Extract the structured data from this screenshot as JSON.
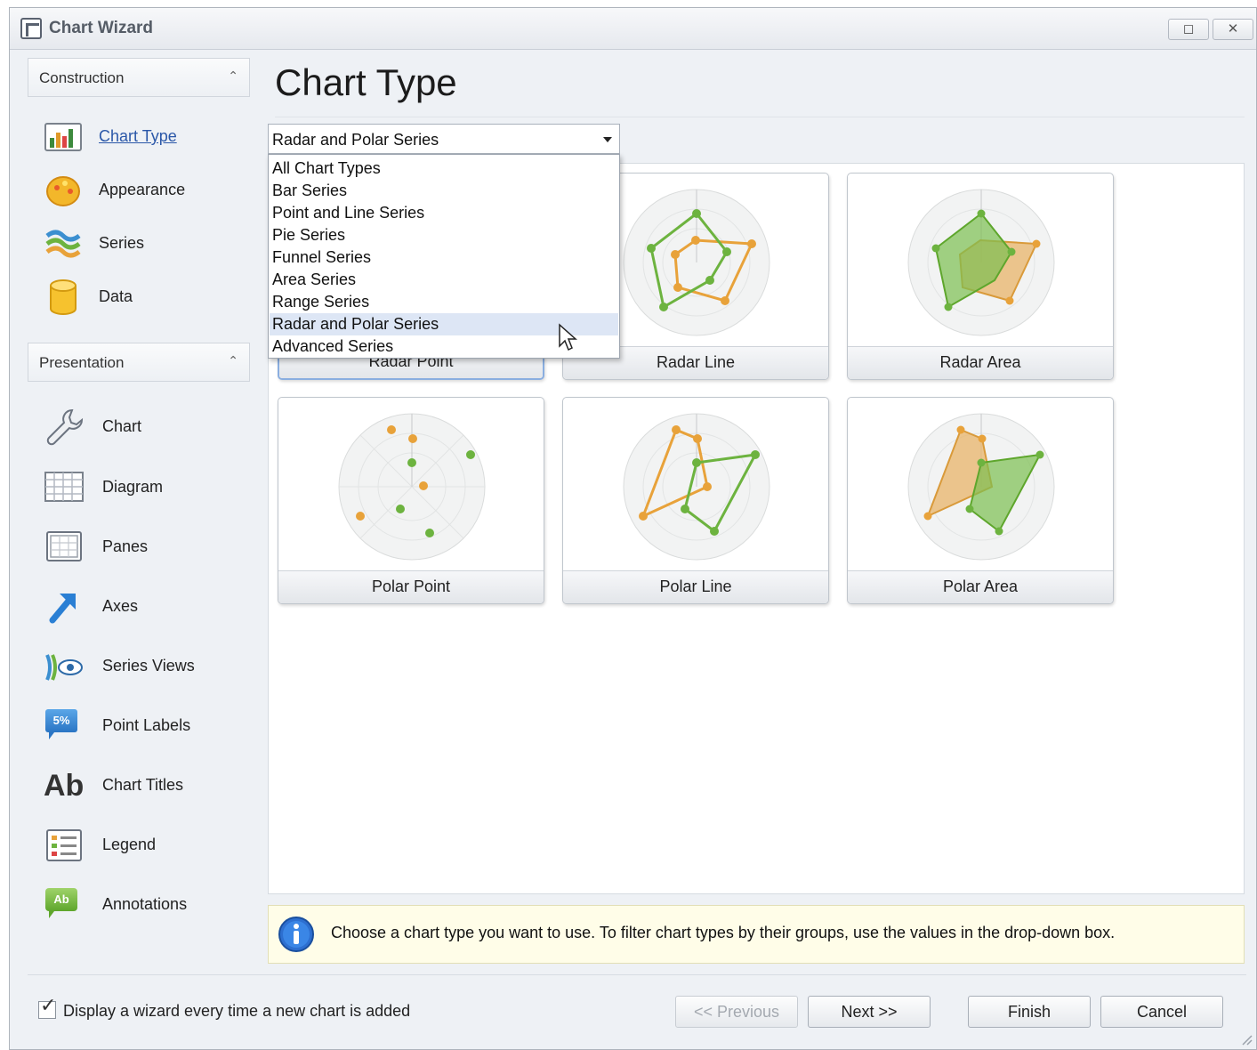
{
  "window": {
    "title": "Chart Wizard",
    "maximize_glyph": "◻",
    "close_glyph": "✕"
  },
  "sidebar": {
    "groups": [
      {
        "label": "Construction",
        "items": [
          {
            "label": "Chart Type",
            "icon": "bar-chart-icon",
            "active": true
          },
          {
            "label": "Appearance",
            "icon": "palette-icon"
          },
          {
            "label": "Series",
            "icon": "series-icon"
          },
          {
            "label": "Data",
            "icon": "database-icon"
          }
        ]
      },
      {
        "label": "Presentation",
        "items": [
          {
            "label": "Chart",
            "icon": "wrench-icon"
          },
          {
            "label": "Diagram",
            "icon": "diagram-grid-icon"
          },
          {
            "label": "Panes",
            "icon": "panes-icon"
          },
          {
            "label": "Axes",
            "icon": "axes-arrow-icon"
          },
          {
            "label": "Series Views",
            "icon": "series-views-icon"
          },
          {
            "label": "Point Labels",
            "icon": "point-labels-icon",
            "badge": "5%"
          },
          {
            "label": "Chart Titles",
            "icon": "chart-titles-icon",
            "glyph": "Ab"
          },
          {
            "label": "Legend",
            "icon": "legend-icon"
          },
          {
            "label": "Annotations",
            "icon": "annotations-icon",
            "badge": "Ab"
          }
        ]
      }
    ]
  },
  "main": {
    "title": "Chart Type",
    "filter": {
      "selected": "Radar and Polar Series",
      "options": [
        "All Chart Types",
        "Bar Series",
        "Point and Line Series",
        "Pie Series",
        "Funnel Series",
        "Area Series",
        "Range Series",
        "Radar and Polar Series",
        "Advanced Series"
      ]
    },
    "chart_types": [
      {
        "label": "Radar Point",
        "selected": true
      },
      {
        "label": "Radar Line"
      },
      {
        "label": "Radar Area"
      },
      {
        "label": "Polar Point"
      },
      {
        "label": "Polar Line"
      },
      {
        "label": "Polar Area"
      }
    ],
    "info_text": "Choose a chart type you want to use. To filter chart types by their groups, use the values in the drop-down box."
  },
  "footer": {
    "checkbox_label": "Display a wizard every time a new chart is added",
    "checkbox_checked": true,
    "buttons": {
      "previous": "<< Previous",
      "next": "Next >>",
      "finish": "Finish",
      "cancel": "Cancel"
    }
  },
  "colors": {
    "series_orange": "#e8a23a",
    "series_green": "#6db33f",
    "selection_blue": "#8aaee0",
    "active_link": "#2a57a8"
  }
}
